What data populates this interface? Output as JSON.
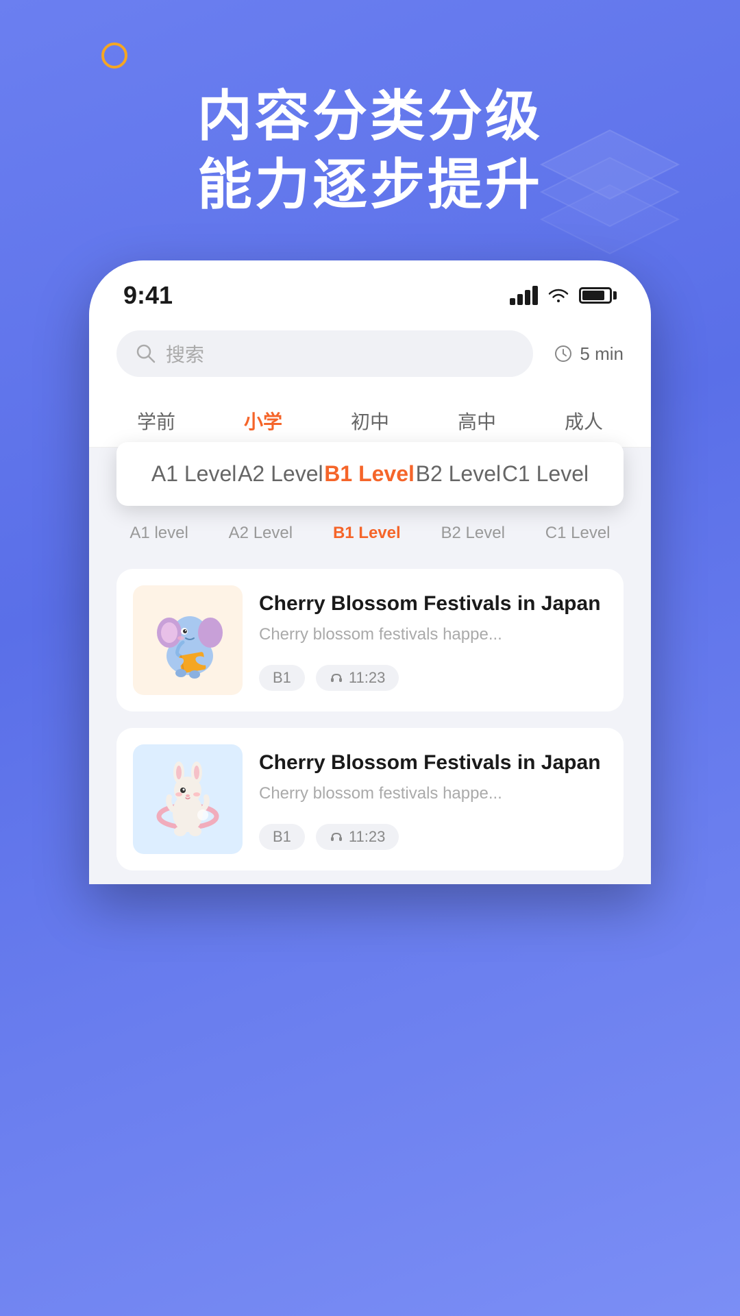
{
  "app": {
    "background_color": "#5a6fe8"
  },
  "hero": {
    "line1": "内容分类分级",
    "line2": "能力逐步提升"
  },
  "status_bar": {
    "time": "9:41",
    "signal_alt": "signal",
    "wifi_alt": "wifi",
    "battery_alt": "battery"
  },
  "search": {
    "placeholder": "搜索",
    "time_filter": "5 min"
  },
  "category_tabs": [
    {
      "label": "学前",
      "active": false
    },
    {
      "label": "小学",
      "active": true
    },
    {
      "label": "初中",
      "active": false
    },
    {
      "label": "高中",
      "active": false
    },
    {
      "label": "成人",
      "active": false
    }
  ],
  "level_popup": {
    "tabs": [
      {
        "label": "A1 Level",
        "active": false
      },
      {
        "label": "A2 Level",
        "active": false
      },
      {
        "label": "B1 Level",
        "active": true
      },
      {
        "label": "B2 Level",
        "active": false
      },
      {
        "label": "C1 Level",
        "active": false
      }
    ]
  },
  "level_subtabs": [
    {
      "label": "A1 level",
      "active": false
    },
    {
      "label": "A2 Level",
      "active": false
    },
    {
      "label": "B1 Level",
      "active": true
    },
    {
      "label": "B2 Level",
      "active": false
    },
    {
      "label": "C1 Level",
      "active": false
    }
  ],
  "content_cards": [
    {
      "id": "card1",
      "title": "Cherry Blossom Festivals in Japan",
      "description": "Cherry blossom festivals happe...",
      "level": "B1",
      "duration": "11:23",
      "thumbnail_type": "warm",
      "mascot": "elephant"
    },
    {
      "id": "card2",
      "title": "Cherry Blossom Festivals in Japan",
      "description": "Cherry blossom festivals happe...",
      "level": "B1",
      "duration": "11:23",
      "thumbnail_type": "blue",
      "mascot": "bunny"
    }
  ]
}
